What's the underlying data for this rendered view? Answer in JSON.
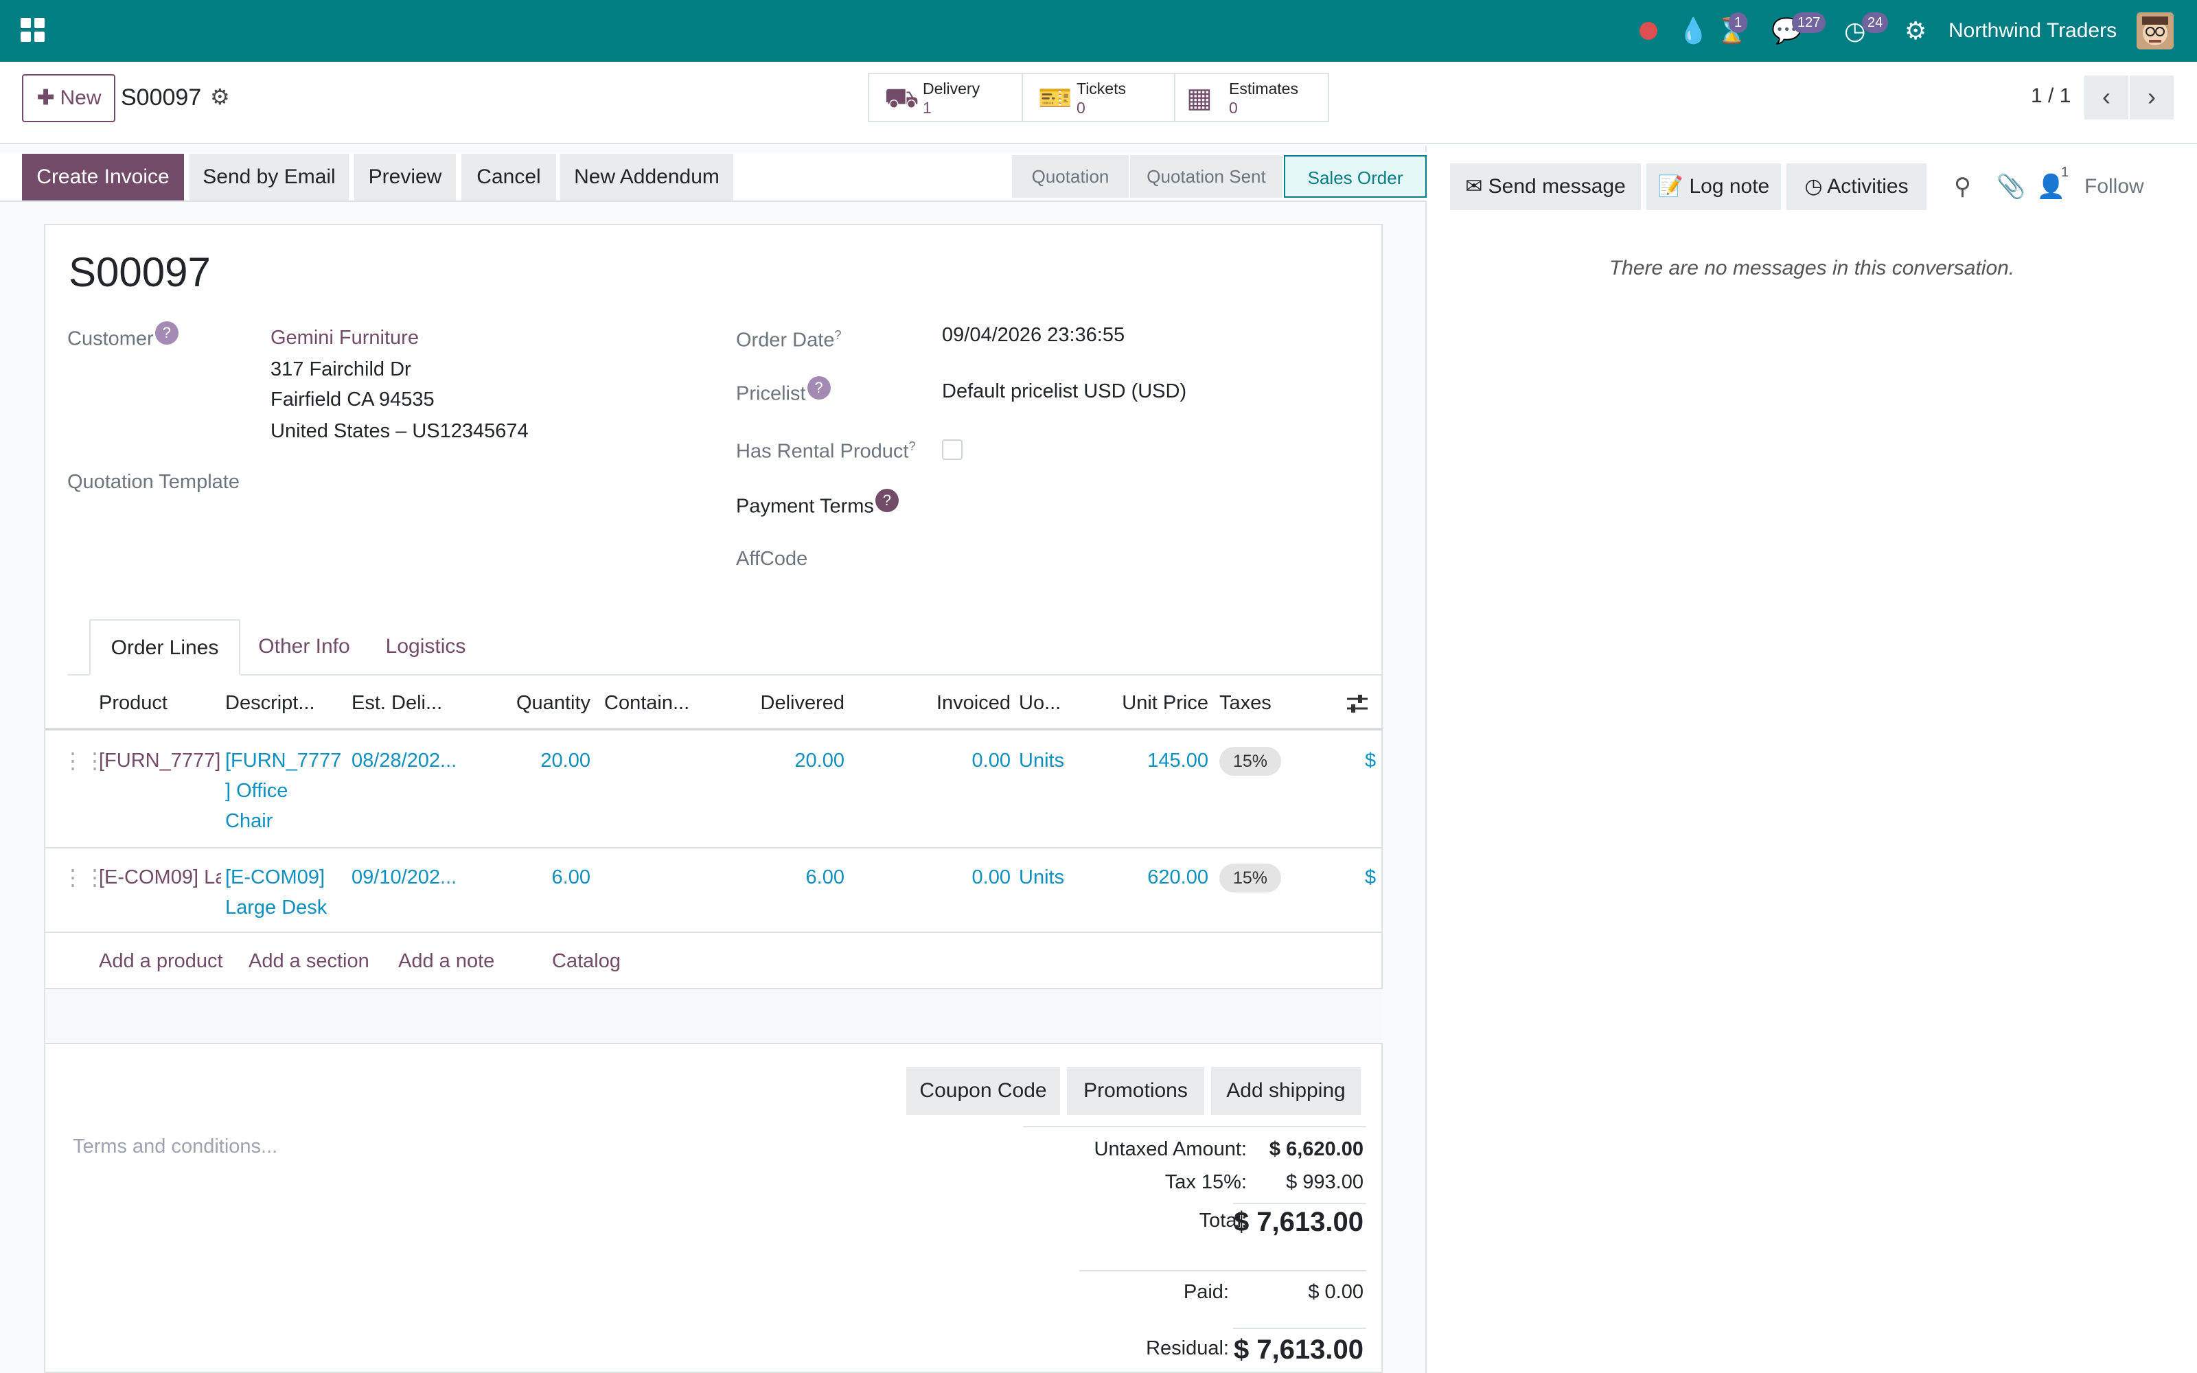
{
  "topbar": {
    "company": "Northwind Traders",
    "activity_badge": "1",
    "messages_badge": "127",
    "timer_badge": "24",
    "icons": [
      "apps-icon",
      "record-icon",
      "drop-icon",
      "hourglass-icon",
      "chat-icon",
      "clock-icon",
      "settings-icon"
    ]
  },
  "control_panel": {
    "new_label": "New",
    "record_name": "S00097",
    "smart_buttons": [
      {
        "label": "Delivery",
        "value": "1"
      },
      {
        "label": "Tickets",
        "value": "0"
      },
      {
        "label": "Estimates",
        "value": "0"
      }
    ],
    "pager": "1 / 1"
  },
  "actions": {
    "create_invoice": "Create Invoice",
    "send_email": "Send by Email",
    "preview": "Preview",
    "cancel": "Cancel",
    "new_addendum": "New Addendum"
  },
  "stages": [
    "Quotation",
    "Quotation Sent",
    "Sales Order"
  ],
  "form": {
    "title": "S00097",
    "customer_label": "Customer",
    "customer_name": "Gemini Furniture",
    "addr1": "317 Fairchild Dr",
    "addr2": "Fairfield CA 94535",
    "addr3": "United States – US12345674",
    "template_label": "Quotation Template",
    "order_date_label": "Order Date",
    "order_date": "09/04/2026 23:36:55",
    "pricelist_label": "Pricelist",
    "pricelist": "Default pricelist USD (USD)",
    "rental_label": "Has Rental Product",
    "payment_terms_label": "Payment Terms",
    "affcode_label": "AffCode",
    "help_mark": "?"
  },
  "tabs": [
    "Order Lines",
    "Other Info",
    "Logistics"
  ],
  "table": {
    "headers": [
      "Product",
      "Descript...",
      "Est. Deli...",
      "Quantity",
      "Contain...",
      "Delivered",
      "Invoiced",
      "Uo...",
      "Unit Price",
      "Taxes"
    ],
    "rows": [
      {
        "product": "[FURN_7777]",
        "desc1": "[FURN_7777",
        "desc2": "] Office",
        "desc3": "Chair",
        "est": "08/28/202...",
        "qty": "20.00",
        "delivered": "20.00",
        "invoiced": "0.00",
        "uom": "Units",
        "price": "145.00",
        "tax": "15%",
        "sub": "$"
      },
      {
        "product": "[E-COM09] La",
        "desc1": "[E-COM09]",
        "desc2": "Large Desk",
        "desc3": "",
        "est": "09/10/202...",
        "qty": "6.00",
        "delivered": "6.00",
        "invoiced": "0.00",
        "uom": "Units",
        "price": "620.00",
        "tax": "15%",
        "sub": "$"
      }
    ],
    "add_product": "Add a product",
    "add_section": "Add a section",
    "add_note": "Add a note",
    "catalog": "Catalog"
  },
  "bottom": {
    "coupon": "Coupon Code",
    "promotions": "Promotions",
    "shipping": "Add shipping",
    "terms_placeholder": "Terms and conditions...",
    "untaxed_label": "Untaxed Amount:",
    "untaxed": "$ 6,620.00",
    "tax_label": "Tax 15%:",
    "tax": "$ 993.00",
    "total_label": "Total:",
    "total": "$ 7,613.00",
    "paid_label": "Paid:",
    "paid": "$ 0.00",
    "residual_label": "Residual:",
    "residual": "$ 7,613.00"
  },
  "chatter": {
    "send_message": "Send message",
    "log_note": "Log note",
    "activities": "Activities",
    "followers_count": "1",
    "follow": "Follow",
    "empty": "There are no messages in this conversation."
  }
}
